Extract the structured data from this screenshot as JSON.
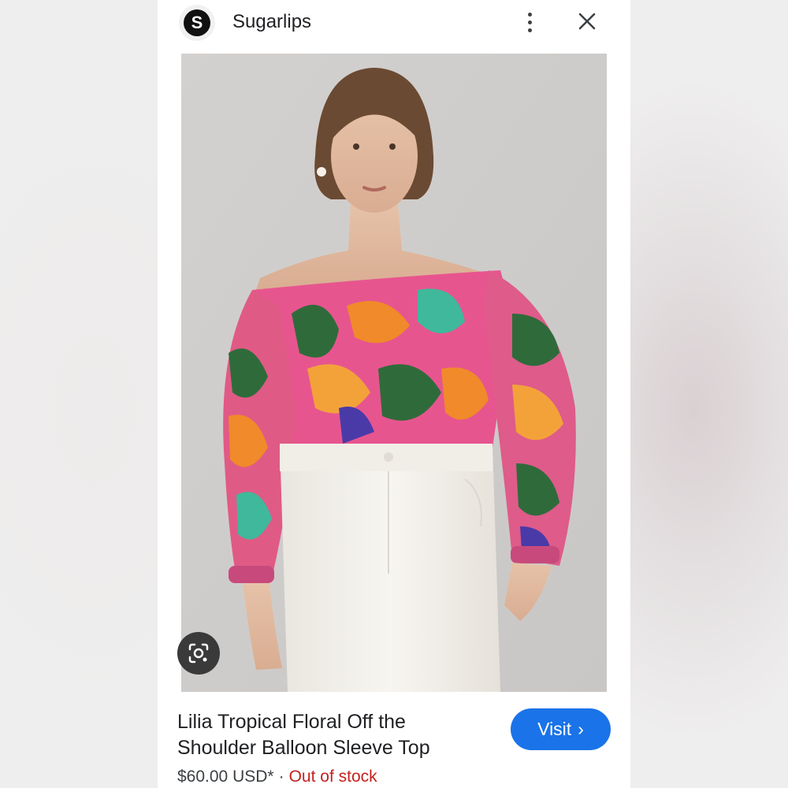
{
  "header": {
    "logo_letter": "S",
    "brand_name": "Sugarlips"
  },
  "product": {
    "title": "Lilia Tropical Floral Off the Shoulder Balloon Sleeve Top",
    "price": "$60.00 USD*",
    "separator": "·",
    "stock_status": "Out of stock",
    "visit_label": "Visit",
    "visit_chevron": "›"
  },
  "icons": {
    "more": "more-vert-icon",
    "close": "close-icon",
    "lens": "google-lens-icon"
  },
  "colors": {
    "accent": "#1a73e8",
    "stock_red": "#c5221f",
    "text": "#202124"
  }
}
